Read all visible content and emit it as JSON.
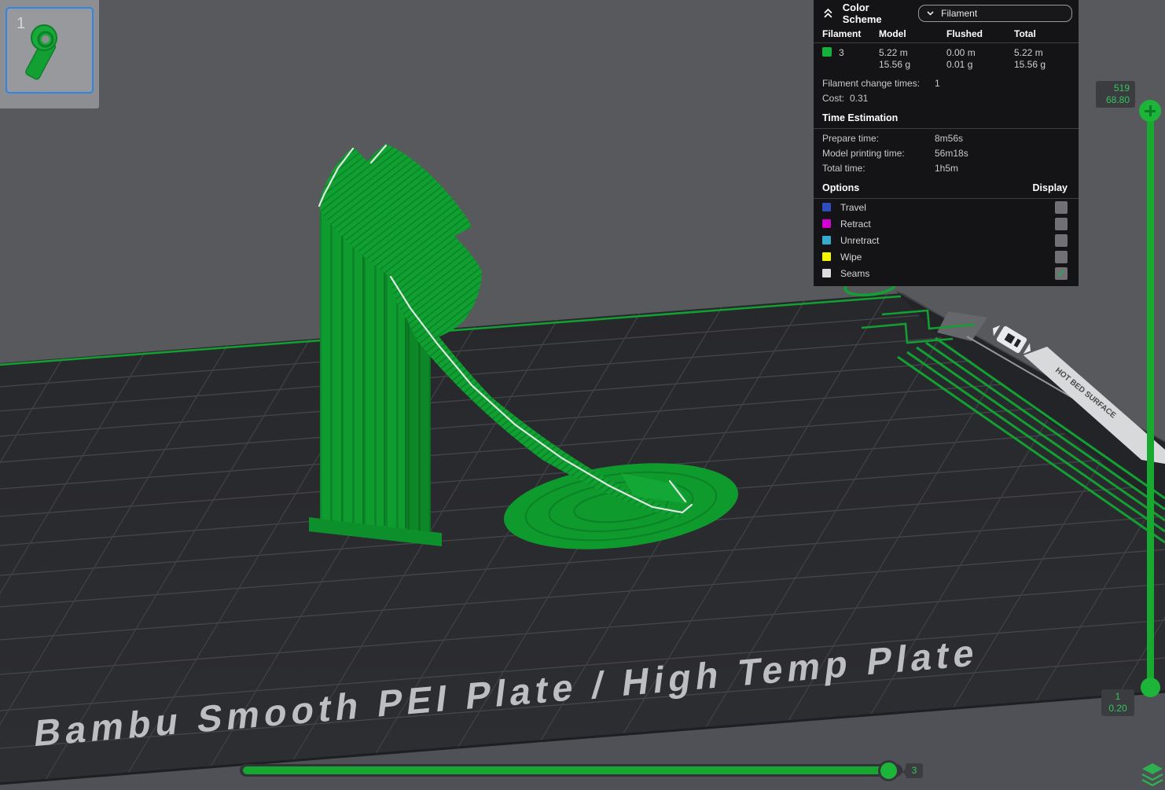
{
  "plate_thumbnail": {
    "index": "1"
  },
  "color_scheme_panel": {
    "title": "Color Scheme",
    "dropdown_value": "Filament",
    "table": {
      "headers": [
        "Filament",
        "Model",
        "Flushed",
        "Total"
      ],
      "rows": [
        {
          "swatch_color": "#16b13c",
          "filament": "3",
          "model_m": "5.22 m",
          "model_g": "15.56 g",
          "flushed_m": "0.00 m",
          "flushed_g": "0.01 g",
          "total_m": "5.22 m",
          "total_g": "15.56 g"
        }
      ]
    },
    "filament_change_times_label": "Filament change times:",
    "filament_change_times_value": "1",
    "cost_label": "Cost:",
    "cost_value": "0.31",
    "time_estimation": {
      "title": "Time Estimation",
      "rows": [
        {
          "label": "Prepare time:",
          "value": "8m56s"
        },
        {
          "label": "Model printing time:",
          "value": "56m18s"
        },
        {
          "label": "Total time:",
          "value": "1h5m"
        }
      ]
    },
    "options": {
      "title": "Options",
      "display_header": "Display",
      "check_glyph": "✓",
      "items": [
        {
          "label": "Travel",
          "color": "#2f4cc0",
          "checked": false
        },
        {
          "label": "Retract",
          "color": "#d400d4",
          "checked": false
        },
        {
          "label": "Unretract",
          "color": "#35aacd",
          "checked": false
        },
        {
          "label": "Wipe",
          "color": "#f5f500",
          "checked": false
        },
        {
          "label": "Seams",
          "color": "#dcdcdc",
          "checked": true
        }
      ]
    }
  },
  "layer_slider": {
    "top_layer": "519",
    "top_height": "68.80",
    "bottom_layer": "1",
    "bottom_height": "0.20"
  },
  "step_slider": {
    "value": "3"
  },
  "build_plate": {
    "label": "Bambu Smooth PEI Plate / High Temp Plate",
    "frame_label": "HOT BED SURFACE"
  },
  "colors": {
    "viewport_bg": "#58595d",
    "plate_bg": "#2a2b2f",
    "grid_line": "#45464a",
    "model_green": "#0fa031",
    "skirt_green": "#12a033",
    "slider_green": "#18a930",
    "handle_green": "#1db43a",
    "badge_text_green": "#35c45c",
    "selected_border_blue": "#2f86e8",
    "panel_bg": "#141416"
  }
}
